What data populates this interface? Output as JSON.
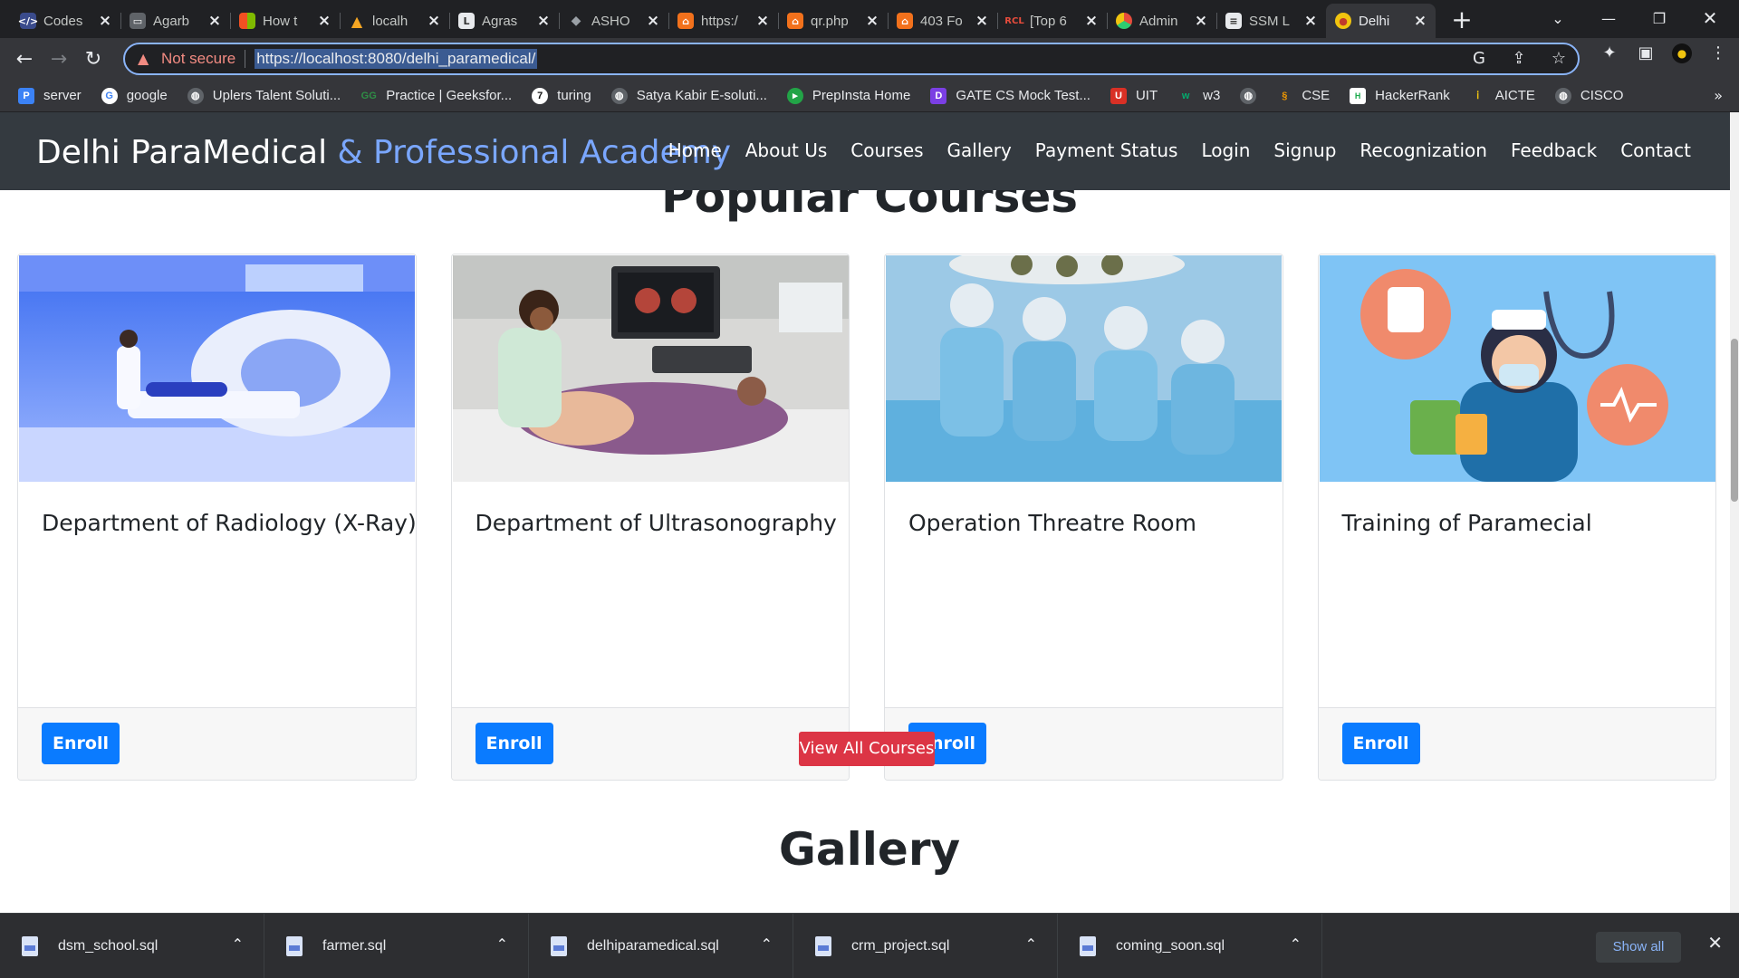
{
  "browser": {
    "tabs": [
      {
        "title": "Codes",
        "favicon": "code-icon",
        "color": "#3a4b8c"
      },
      {
        "title": "Agarb",
        "favicon": "cart-icon",
        "color": "#5f6368"
      },
      {
        "title": "How t",
        "favicon": "windows-icon",
        "color": "#f25022"
      },
      {
        "title": "localh",
        "favicon": "xampp-icon",
        "color": "#f5a623"
      },
      {
        "title": "Agras",
        "favicon": "page-icon",
        "color": "#e8eaed"
      },
      {
        "title": "ASHO",
        "favicon": "grad-cap-icon",
        "color": "#9aa0a6"
      },
      {
        "title": "https:/",
        "favicon": "pma-icon",
        "color": "#f2711c"
      },
      {
        "title": "qr.php",
        "favicon": "pma-icon",
        "color": "#f2711c"
      },
      {
        "title": "403 Fo",
        "favicon": "pma-icon",
        "color": "#f2711c"
      },
      {
        "title": "[Top 6",
        "favicon": "rcl-icon",
        "color": "#c0392b"
      },
      {
        "title": "Admin",
        "favicon": "circle-logo-icon",
        "color": "#e74c3c"
      },
      {
        "title": "SSM L",
        "favicon": "doc-icon",
        "color": "#e8eaed"
      },
      {
        "title": "Delhi",
        "favicon": "shield-logo-icon",
        "color": "#f1c40f"
      }
    ],
    "active_tab_index": 12,
    "security_label": "Not secure",
    "url": "https://localhost:8080/delhi_paramedical/",
    "bookmarks": [
      {
        "label": "server",
        "icon": "p-icon",
        "color": "#3b82f6"
      },
      {
        "label": "google",
        "icon": "google-icon",
        "color": "#4285f4"
      },
      {
        "label": "Uplers Talent Soluti...",
        "icon": "globe-icon",
        "color": "#5f6368"
      },
      {
        "label": "Practice | Geeksfor...",
        "icon": "gfg-icon",
        "color": "#2f8d46"
      },
      {
        "label": "turing",
        "icon": "turing-icon",
        "color": "#111111"
      },
      {
        "label": "Satya Kabir E-soluti...",
        "icon": "globe-icon",
        "color": "#5f6368"
      },
      {
        "label": "PrepInsta Home",
        "icon": "prepinsta-icon",
        "color": "#22a447"
      },
      {
        "label": "GATE CS Mock Test...",
        "icon": "gate-icon",
        "color": "#7b3fe4"
      },
      {
        "label": "UIT",
        "icon": "uit-icon",
        "color": "#d93025"
      },
      {
        "label": "w3",
        "icon": "w3-icon",
        "color": "#04aa6d"
      },
      {
        "label": "",
        "icon": "globe-icon",
        "color": "#5f6368"
      },
      {
        "label": "CSE",
        "icon": "cse-icon",
        "color": "#f29900"
      },
      {
        "label": "HackerRank",
        "icon": "hackerrank-icon",
        "color": "#1ba94c"
      },
      {
        "label": "AICTE",
        "icon": "aicte-icon",
        "color": "#1a73e8"
      },
      {
        "label": "CISCO",
        "icon": "globe-icon",
        "color": "#5f6368"
      }
    ]
  },
  "site": {
    "brand_main": "Delhi ParaMedical",
    "brand_accent": " & Professional Academy",
    "menu": [
      "Home",
      "About Us",
      "Courses",
      "Gallery",
      "Payment Status",
      "Login",
      "Signup",
      "Recognization",
      "Feedback",
      "Contact"
    ],
    "popular_title": "Popular Courses",
    "courses": [
      {
        "title": "Department of Radiology (X-Ray)",
        "button": "Enroll"
      },
      {
        "title": "Department of Ultrasonography",
        "button": "Enroll"
      },
      {
        "title": "Operation Threatre Room",
        "button": "Enroll"
      },
      {
        "title": "Training of Paramecial",
        "button": "Enroll"
      }
    ],
    "view_all_label": "View All Courses",
    "gallery_title": "Gallery"
  },
  "downloads": {
    "files": [
      "dsm_school.sql",
      "farmer.sql",
      "delhiparamedical.sql",
      "crm_project.sql",
      "coming_soon.sql"
    ],
    "show_all_label": "Show all"
  },
  "colors": {
    "navbar": "#343a40",
    "brand_accent": "#7aa7ff",
    "enroll_button": "#0a7bff",
    "view_all_button": "#dc3545"
  }
}
